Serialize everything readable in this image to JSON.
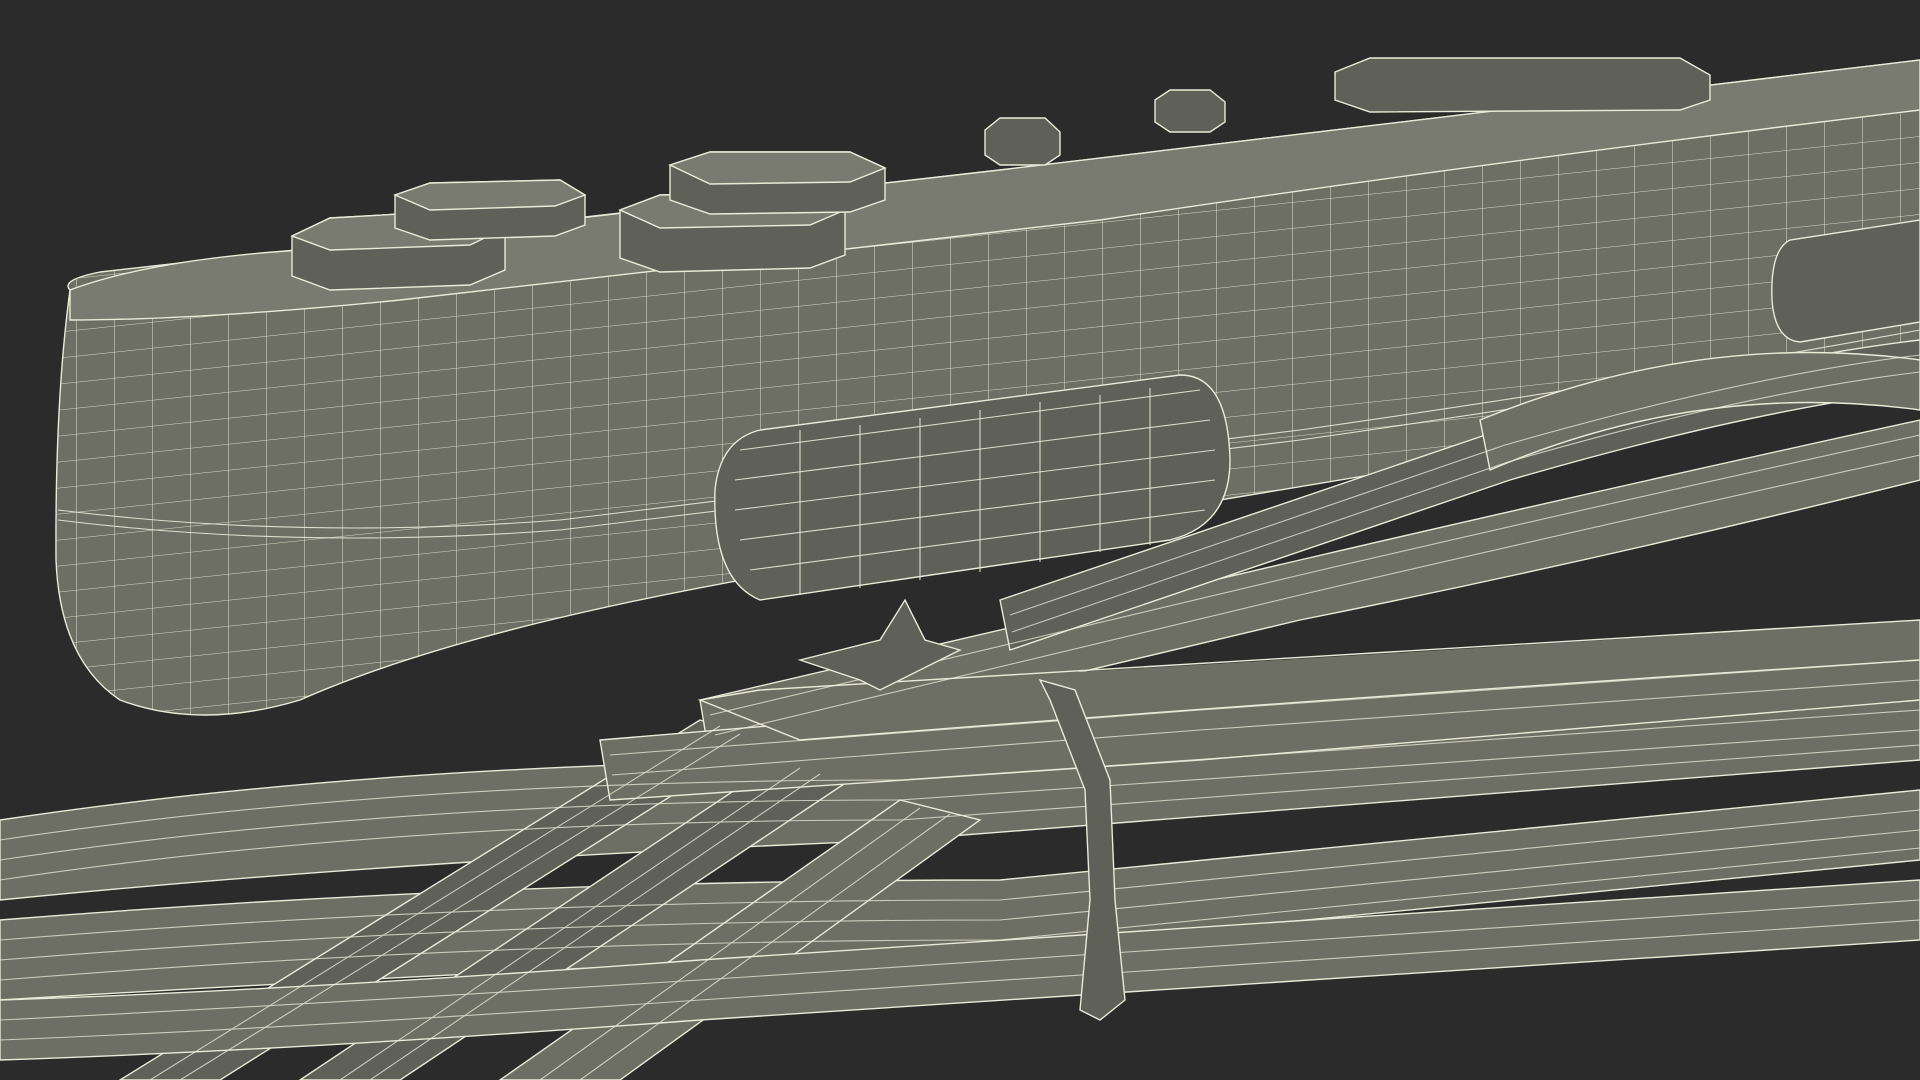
{
  "scene": {
    "background_color": "#2b2b2b",
    "mesh_fill_color": "#6e6f64",
    "wireframe_color": "#e9ead8"
  }
}
